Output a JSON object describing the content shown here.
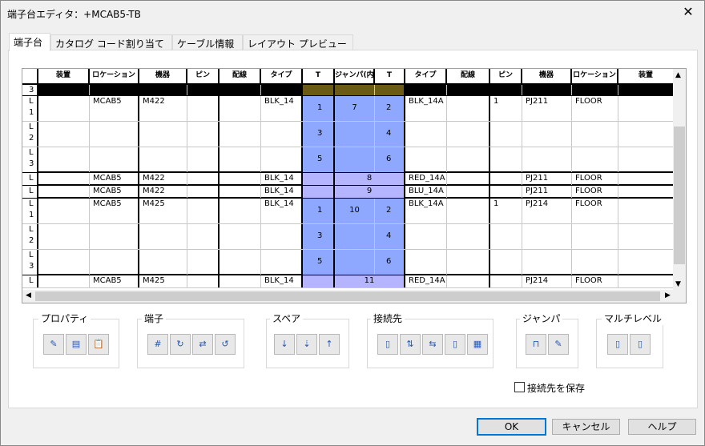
{
  "window": {
    "title": "端子台エディタ：+MCAB5-TB",
    "close": "✕"
  },
  "tabs": [
    "端子台",
    "カタログ コード割り当て",
    "ケーブル情報",
    "レイアウト プレビュー"
  ],
  "headers": [
    "装置",
    "ロケーション",
    "機器",
    "ピン",
    "配線",
    "タイプ",
    "T",
    "ジャンパ(内部)",
    "T",
    "タイプ",
    "配線",
    "ピン",
    "機器",
    "ロケーション",
    "装置"
  ],
  "rows": [
    {
      "lab": "3",
      "left": {
        "loc": "",
        "dev": "",
        "type": ""
      },
      "t1": "",
      "jp": "",
      "t2": "",
      "right": {
        "type": "",
        "pin": "",
        "dev": "",
        "loc": ""
      },
      "dark": true
    },
    {
      "lab": "L 1",
      "left": {
        "loc": "MCAB5",
        "dev": "M422",
        "type": "BLK_14"
      },
      "t1": "1",
      "jp": "7",
      "t2": "2",
      "right": {
        "type": "BLK_14A",
        "pin": "1",
        "dev": "PJ211",
        "loc": "FLOOR"
      }
    },
    {
      "lab": "L 2",
      "left": {
        "loc": "",
        "dev": "",
        "type": ""
      },
      "t1": "3",
      "jp": "",
      "t2": "4",
      "right": {
        "type": "",
        "pin": "",
        "dev": "",
        "loc": ""
      }
    },
    {
      "lab": "L 3",
      "left": {
        "loc": "",
        "dev": "",
        "type": ""
      },
      "t1": "5",
      "jp": "",
      "t2": "6",
      "right": {
        "type": "",
        "pin": "",
        "dev": "",
        "loc": ""
      }
    },
    {
      "lab": "L",
      "left": {
        "loc": "MCAB5",
        "dev": "M422",
        "type": "BLK_14"
      },
      "t1": "",
      "jp": "8",
      "t2": "",
      "right": {
        "type": "RED_14A",
        "pin": "",
        "dev": "PJ211",
        "loc": "FLOOR"
      }
    },
    {
      "lab": "L",
      "left": {
        "loc": "MCAB5",
        "dev": "M422",
        "type": "BLK_14"
      },
      "t1": "",
      "jp": "9",
      "t2": "",
      "right": {
        "type": "BLU_14A",
        "pin": "",
        "dev": "PJ211",
        "loc": "FLOOR"
      }
    },
    {
      "lab": "L 1",
      "left": {
        "loc": "MCAB5",
        "dev": "M425",
        "type": "BLK_14"
      },
      "t1": "1",
      "jp": "10",
      "t2": "2",
      "right": {
        "type": "BLK_14A",
        "pin": "1",
        "dev": "PJ214",
        "loc": "FLOOR"
      }
    },
    {
      "lab": "L 2",
      "left": {
        "loc": "",
        "dev": "",
        "type": ""
      },
      "t1": "3",
      "jp": "",
      "t2": "4",
      "right": {
        "type": "",
        "pin": "",
        "dev": "",
        "loc": ""
      }
    },
    {
      "lab": "L 3",
      "left": {
        "loc": "",
        "dev": "",
        "type": ""
      },
      "t1": "5",
      "jp": "",
      "t2": "6",
      "right": {
        "type": "",
        "pin": "",
        "dev": "",
        "loc": ""
      }
    },
    {
      "lab": "L",
      "left": {
        "loc": "MCAB5",
        "dev": "M425",
        "type": "BLK_14"
      },
      "t1": "",
      "jp": "11",
      "t2": "",
      "right": {
        "type": "RED_14A",
        "pin": "",
        "dev": "PJ214",
        "loc": "FLOOR"
      }
    }
  ],
  "groups": {
    "property": "プロパティ",
    "terminal": "端子",
    "spare": "スペア",
    "connect": "接続先",
    "jumper": "ジャンパ",
    "multi": "マルチレベル"
  },
  "save_checkbox": "接続先を保存",
  "buttons": {
    "ok": "OK",
    "cancel": "キャンセル",
    "help": "ヘルプ"
  },
  "scrollbar": {
    "up": "▲",
    "down": "▼",
    "left": "◀",
    "right": "▶"
  }
}
